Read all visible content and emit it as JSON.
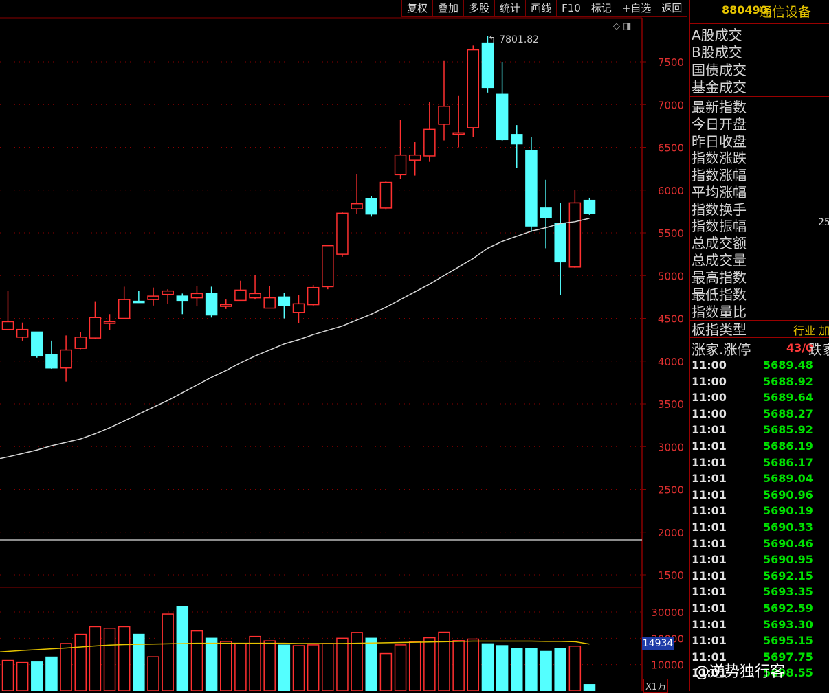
{
  "toolbar": {
    "buttons": [
      "复权",
      "叠加",
      "多股",
      "统计",
      "画线",
      "F10",
      "标记",
      "+自选",
      "返回"
    ]
  },
  "header": {
    "code": "880490",
    "name": "通信设备"
  },
  "stats": {
    "labels": [
      "A股成交",
      "B股成交",
      "国债成交",
      "基金成交",
      "最新指数",
      "今日开盘",
      "昨日收盘",
      "指数涨跌",
      "指数涨幅",
      "平均涨幅",
      "指数换手",
      "指数振幅",
      "总成交额",
      "总成交量",
      "最高指数",
      "最低指数",
      "指数量比"
    ],
    "partial_value": "25",
    "type_label": "板指类型",
    "type_value": "行业 加",
    "updown_label": "涨家.涨停",
    "updown_value": "43/0",
    "down_label": "跌家."
  },
  "ticks": [
    {
      "time": "11:00",
      "price": "5689.48"
    },
    {
      "time": "11:00",
      "price": "5688.92"
    },
    {
      "time": "11:00",
      "price": "5689.64"
    },
    {
      "time": "11:00",
      "price": "5688.27"
    },
    {
      "time": "11:01",
      "price": "5685.92"
    },
    {
      "time": "11:01",
      "price": "5686.19"
    },
    {
      "time": "11:01",
      "price": "5686.17"
    },
    {
      "time": "11:01",
      "price": "5689.04"
    },
    {
      "time": "11:01",
      "price": "5690.96"
    },
    {
      "time": "11:01",
      "price": "5690.19"
    },
    {
      "time": "11:01",
      "price": "5690.33"
    },
    {
      "time": "11:01",
      "price": "5690.46"
    },
    {
      "time": "11:01",
      "price": "5690.95"
    },
    {
      "time": "11:01",
      "price": "5692.15"
    },
    {
      "time": "11:01",
      "price": "5693.35"
    },
    {
      "time": "11:01",
      "price": "5692.59"
    },
    {
      "time": "11:01",
      "price": "5693.30"
    },
    {
      "time": "11:01",
      "price": "5695.15"
    },
    {
      "time": "11:01",
      "price": "5697.75"
    },
    {
      "time": "11:01",
      "price": "5698.55"
    }
  ],
  "colors": {
    "up": "#ff3030",
    "down": "#54ffff",
    "ma": "#d8d8d8",
    "vol_ma": "#e6c400",
    "grid": "#8a0000",
    "axis_text": "#e03030"
  },
  "watermark": "@逆势独行客",
  "chart_data": {
    "type": "candlestick",
    "price_axis": {
      "ticks": [
        "7500",
        "7000",
        "6500",
        "6000",
        "5500",
        "5000",
        "4500",
        "4000",
        "3500",
        "3000",
        "2500",
        "2000",
        "1500"
      ],
      "range": [
        1400,
        7850
      ]
    },
    "peak_label": "7801.82",
    "volume_axis": {
      "ticks": [
        "30000",
        "20000",
        "10000"
      ],
      "range": [
        0,
        36000
      ]
    },
    "volume_current": "14934",
    "volume_unit": "X1万",
    "candles": [
      {
        "o": 4370,
        "h": 4820,
        "l": 4370,
        "c": 4460
      },
      {
        "o": 4280,
        "h": 4450,
        "l": 4240,
        "c": 4370
      },
      {
        "o": 4340,
        "h": 4340,
        "l": 4040,
        "c": 4060
      },
      {
        "o": 4080,
        "h": 4240,
        "l": 3910,
        "c": 3920
      },
      {
        "o": 3920,
        "h": 4300,
        "l": 3760,
        "c": 4130
      },
      {
        "o": 4150,
        "h": 4340,
        "l": 4140,
        "c": 4280
      },
      {
        "o": 4270,
        "h": 4700,
        "l": 4260,
        "c": 4510
      },
      {
        "o": 4440,
        "h": 4550,
        "l": 4360,
        "c": 4460
      },
      {
        "o": 4500,
        "h": 4870,
        "l": 4500,
        "c": 4720
      },
      {
        "o": 4700,
        "h": 4820,
        "l": 4680,
        "c": 4690
      },
      {
        "o": 4720,
        "h": 4860,
        "l": 4650,
        "c": 4760
      },
      {
        "o": 4780,
        "h": 4840,
        "l": 4670,
        "c": 4820
      },
      {
        "o": 4760,
        "h": 4790,
        "l": 4550,
        "c": 4710
      },
      {
        "o": 4740,
        "h": 4880,
        "l": 4640,
        "c": 4790
      },
      {
        "o": 4790,
        "h": 4870,
        "l": 4510,
        "c": 4540
      },
      {
        "o": 4640,
        "h": 4720,
        "l": 4610,
        "c": 4660
      },
      {
        "o": 4710,
        "h": 4940,
        "l": 4710,
        "c": 4830
      },
      {
        "o": 4740,
        "h": 5010,
        "l": 4720,
        "c": 4790
      },
      {
        "o": 4620,
        "h": 4880,
        "l": 4620,
        "c": 4740
      },
      {
        "o": 4750,
        "h": 4800,
        "l": 4500,
        "c": 4650
      },
      {
        "o": 4570,
        "h": 4770,
        "l": 4440,
        "c": 4670
      },
      {
        "o": 4660,
        "h": 4890,
        "l": 4640,
        "c": 4860
      },
      {
        "o": 4870,
        "h": 5360,
        "l": 4840,
        "c": 5350
      },
      {
        "o": 5250,
        "h": 5740,
        "l": 5220,
        "c": 5730
      },
      {
        "o": 5780,
        "h": 6190,
        "l": 5720,
        "c": 5840
      },
      {
        "o": 5900,
        "h": 5930,
        "l": 5690,
        "c": 5720
      },
      {
        "o": 5790,
        "h": 6110,
        "l": 5770,
        "c": 6090
      },
      {
        "o": 6180,
        "h": 6820,
        "l": 6130,
        "c": 6410
      },
      {
        "o": 6350,
        "h": 6560,
        "l": 6170,
        "c": 6410
      },
      {
        "o": 6400,
        "h": 7030,
        "l": 6330,
        "c": 6710
      },
      {
        "o": 6770,
        "h": 7510,
        "l": 6580,
        "c": 6980
      },
      {
        "o": 6660,
        "h": 7100,
        "l": 6500,
        "c": 6670
      },
      {
        "o": 6730,
        "h": 7690,
        "l": 6620,
        "c": 7640
      },
      {
        "o": 7720,
        "h": 7800,
        "l": 7140,
        "c": 7200
      },
      {
        "o": 7120,
        "h": 7500,
        "l": 6570,
        "c": 6590
      },
      {
        "o": 6650,
        "h": 6760,
        "l": 6260,
        "c": 6540
      },
      {
        "o": 6460,
        "h": 6620,
        "l": 5510,
        "c": 5580
      },
      {
        "o": 5790,
        "h": 6120,
        "l": 5320,
        "c": 5680
      },
      {
        "o": 5610,
        "h": 5850,
        "l": 4770,
        "c": 5160
      },
      {
        "o": 5100,
        "h": 6000,
        "l": 5090,
        "c": 5850
      },
      {
        "o": 5880,
        "h": 5910,
        "l": 5710,
        "c": 5730
      }
    ],
    "ma": [
      2880,
      2920,
      2960,
      3010,
      3050,
      3090,
      3150,
      3220,
      3300,
      3380,
      3460,
      3540,
      3630,
      3720,
      3810,
      3890,
      3980,
      4060,
      4130,
      4200,
      4250,
      4310,
      4360,
      4410,
      4480,
      4550,
      4630,
      4720,
      4810,
      4900,
      5000,
      5100,
      5200,
      5320,
      5400,
      5460,
      5520,
      5560,
      5610,
      5630,
      5670
    ],
    "volumes": [
      11600,
      10800,
      11000,
      12900,
      18000,
      21500,
      24400,
      23800,
      24400,
      21500,
      13000,
      29200,
      32100,
      22800,
      20000,
      18800,
      18000,
      20700,
      19000,
      17400,
      17200,
      17500,
      18000,
      20000,
      22200,
      20000,
      14200,
      17500,
      18800,
      20200,
      22300,
      19100,
      19700,
      17900,
      17200,
      16200,
      16100,
      15000,
      16000,
      17000,
      2400
    ],
    "vol_ma": [
      15000,
      15400,
      15700,
      16000,
      16300,
      16700,
      17100,
      17400,
      17600,
      17700,
      17800,
      17900,
      18000,
      18100,
      18100,
      18100,
      18100,
      18100,
      18100,
      18100,
      18000,
      18000,
      18000,
      18000,
      18100,
      18200,
      18300,
      18400,
      18500,
      18600,
      18700,
      18800,
      18900,
      18900,
      18900,
      18900,
      18900,
      18800,
      18800,
      18700,
      17800
    ]
  }
}
